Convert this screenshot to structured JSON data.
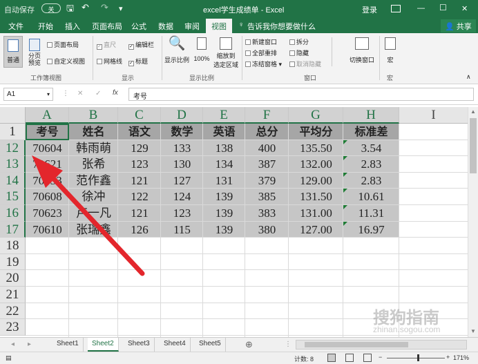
{
  "titlebar": {
    "autosave_label": "自动保存",
    "autosave_state": "关",
    "title": "excel学生成绩单 - Excel",
    "login": "登录",
    "min": "—",
    "restore": "☐",
    "close": "✕",
    "qat_save": "🖫",
    "qat_undo": "↶",
    "qat_redo": "↷",
    "qat_more": "▾"
  },
  "ribbon_tabs": {
    "file": "文件",
    "home": "开始",
    "insert": "插入",
    "layout": "页面布局",
    "formulas": "公式",
    "data": "数据",
    "review": "审阅",
    "view": "视图",
    "tell": "告诉我你想要做什么",
    "share": "共享"
  },
  "ribbon": {
    "normal": "普通",
    "page_break": "分页预览",
    "page_layout": "页面布局",
    "custom_views": "自定义视图",
    "group_views": "工作簿视图",
    "ruler": "直尺",
    "gridlines": "网格线",
    "formula_bar": "编辑栏",
    "headings": "标题",
    "group_show": "显示",
    "zoom": "显示比例",
    "zoom100": "100%",
    "zoom_sel_1": "缩放到",
    "zoom_sel_2": "选定区域",
    "group_zoom": "显示比例",
    "new_window": "新建窗口",
    "arrange_all": "全部重排",
    "freeze": "冻结窗格",
    "split": "拆分",
    "hide": "隐藏",
    "unhide": "取消隐藏",
    "switch_window": "切换窗口",
    "group_window": "窗口",
    "macros": "宏",
    "group_macros": "宏"
  },
  "formula_bar": {
    "name_box": "A1",
    "fx": "fx",
    "content": "考号",
    "cancel": "✕",
    "enter": "✓"
  },
  "grid": {
    "columns": [
      "A",
      "B",
      "C",
      "D",
      "E",
      "F",
      "G",
      "H",
      "I"
    ],
    "header_row": {
      "num": "1",
      "cells": [
        "考号",
        "姓名",
        "语文",
        "数学",
        "英语",
        "总分",
        "平均分",
        "标准差"
      ]
    },
    "rows": [
      {
        "num": "12",
        "cells": [
          "70604",
          "韩雨萌",
          "129",
          "133",
          "138",
          "400",
          "135.50",
          "3.54"
        ]
      },
      {
        "num": "13",
        "cells": [
          "70621",
          "张希",
          "123",
          "130",
          "134",
          "387",
          "132.00",
          "2.83"
        ]
      },
      {
        "num": "14",
        "cells": [
          "70633",
          "范作鑫",
          "121",
          "127",
          "131",
          "379",
          "129.00",
          "2.83"
        ]
      },
      {
        "num": "15",
        "cells": [
          "70608",
          "徐冲",
          "122",
          "124",
          "139",
          "385",
          "131.50",
          "10.61"
        ]
      },
      {
        "num": "16",
        "cells": [
          "70623",
          "卢一凡",
          "121",
          "123",
          "139",
          "383",
          "131.00",
          "11.31"
        ]
      },
      {
        "num": "17",
        "cells": [
          "70610",
          "张瑞鑫",
          "126",
          "115",
          "139",
          "380",
          "127.00",
          "16.97"
        ]
      }
    ],
    "empty_rows": [
      "18",
      "19",
      "20",
      "21",
      "22",
      "23"
    ]
  },
  "sheets": {
    "tabs": [
      "Sheet1",
      "Sheet2",
      "Sheet3",
      "Sheet4",
      "Sheet5"
    ],
    "active": "Sheet2",
    "add": "⊕"
  },
  "statusbar": {
    "count": "计数: 8",
    "zoom_minus": "−",
    "zoom_plus": "+",
    "zoom": "171%"
  },
  "watermark": {
    "text1": "搜狗指南",
    "text2": "zhinan.sogou.com"
  },
  "colors": {
    "excel_green": "#217346",
    "selection_fill": "#c6c6c6",
    "header_fill": "#a6a6a6",
    "arrow": "#e3262c"
  }
}
